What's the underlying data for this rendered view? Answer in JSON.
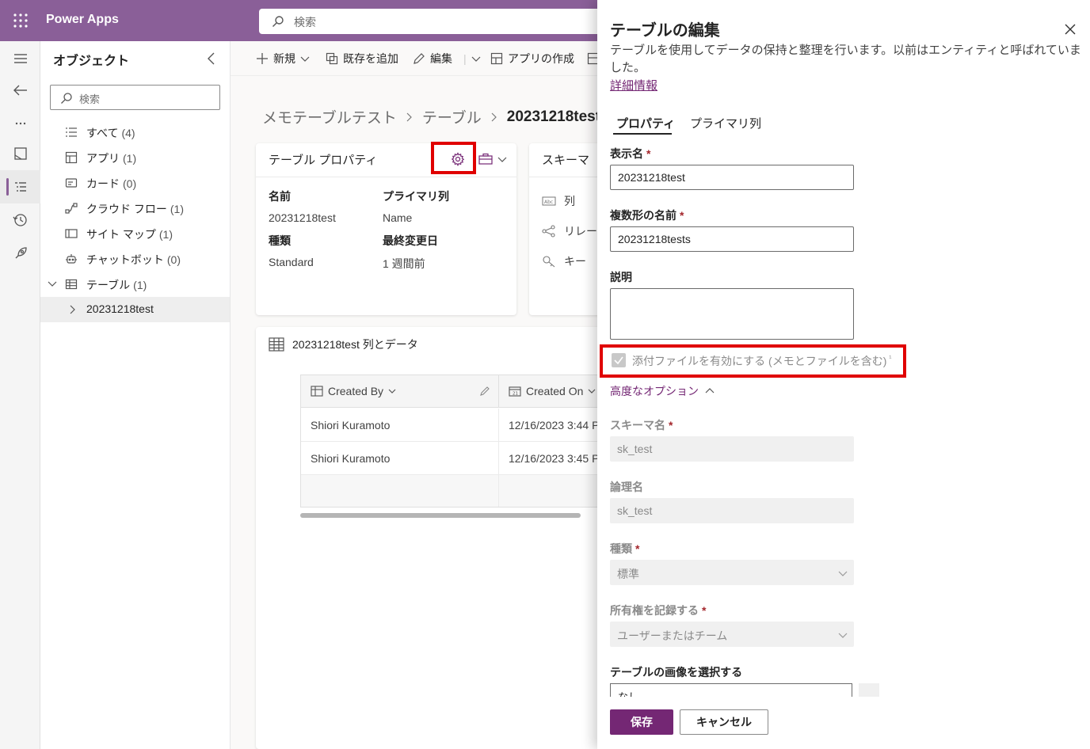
{
  "app": {
    "name": "Power Apps",
    "search_placeholder": "検索"
  },
  "objects": {
    "title": "オブジェクト",
    "search_placeholder": "検索",
    "items": [
      {
        "label": "すべて",
        "count": "(4)"
      },
      {
        "label": "アプリ",
        "count": "(1)"
      },
      {
        "label": "カード",
        "count": "(0)"
      },
      {
        "label": "クラウド フロー",
        "count": "(1)"
      },
      {
        "label": "サイト マップ",
        "count": "(1)"
      },
      {
        "label": "チャットボット",
        "count": "(0)"
      },
      {
        "label": "テーブル",
        "count": "(1)"
      }
    ],
    "sub_item": "20231218test"
  },
  "cmdbar": {
    "new": "新規",
    "add_existing": "既存を追加",
    "edit": "編集",
    "create_app": "アプリの作成"
  },
  "breadcrumb": {
    "root": "メモテーブルテスト",
    "mid": "テーブル",
    "current": "20231218test"
  },
  "props_card": {
    "title": "テーブル プロパティ",
    "name_label": "名前",
    "name_value": "20231218test",
    "primary_label": "プライマリ列",
    "primary_value": "Name",
    "type_label": "種類",
    "type_value": "Standard",
    "modified_label": "最終変更日",
    "modified_value": "1 週間前"
  },
  "schema_card": {
    "title": "スキーマ",
    "columns": "列",
    "relations": "リレー",
    "keys": "キー"
  },
  "data_card": {
    "title": "20231218test 列とデータ",
    "headers": [
      "Created By",
      "Created On"
    ],
    "rows": [
      [
        "Shiori Kuramoto",
        "12/16/2023 3:44 P"
      ],
      [
        "Shiori Kuramoto",
        "12/16/2023 3:45 P"
      ]
    ]
  },
  "panel": {
    "title": "テーブルの編集",
    "description": "テーブルを使用してデータの保持と整理を行います。以前はエンティティと呼ばれていました。",
    "learn_more": "詳細情報",
    "tabs": [
      "プロパティ",
      "プライマリ列"
    ],
    "display_name_label": "表示名",
    "display_name_value": "20231218test",
    "plural_label": "複数形の名前",
    "plural_value": "20231218tests",
    "desc_label": "説明",
    "attach_label": "添付ファイルを有効にする (メモとファイルを含む)",
    "attach_sup": "¹",
    "advanced": "高度なオプション",
    "schema_label": "スキーマ名",
    "schema_value": "sk_test",
    "logical_label": "論理名",
    "logical_value": "sk_test",
    "type_label": "種類",
    "type_value": "標準",
    "ownership_label": "所有権を記録する",
    "ownership_value": "ユーザーまたはチーム",
    "image_label": "テーブルの画像を選択する",
    "image_value": "なし",
    "required_mark": "*",
    "save": "保存",
    "cancel": "キャンセル"
  }
}
